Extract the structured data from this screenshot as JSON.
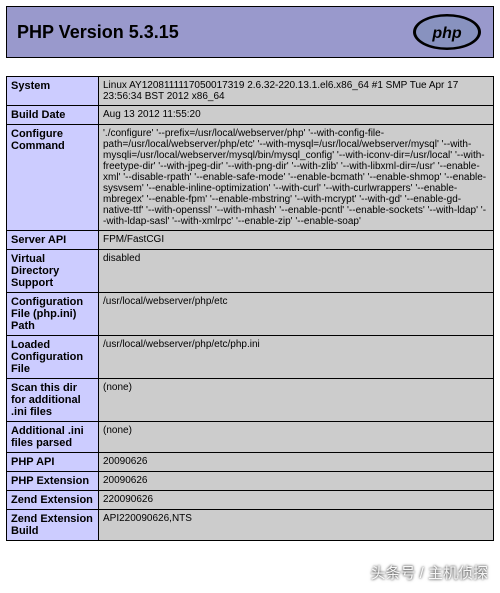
{
  "header": {
    "title": "PHP Version 5.3.15",
    "logo_name": "php-logo"
  },
  "rows": [
    {
      "label": "System",
      "value": "Linux AY1208111117050017319 2.6.32-220.13.1.el6.x86_64 #1 SMP Tue Apr 17 23:56:34 BST 2012 x86_64"
    },
    {
      "label": "Build Date",
      "value": "Aug 13 2012 11:55:20"
    },
    {
      "label": "Configure Command",
      "value": "'./configure' '--prefix=/usr/local/webserver/php' '--with-config-file-path=/usr/local/webserver/php/etc' '--with-mysql=/usr/local/webserver/mysql' '--with-mysqli=/usr/local/webserver/mysql/bin/mysql_config' '--with-iconv-dir=/usr/local' '--with-freetype-dir' '--with-jpeg-dir' '--with-png-dir' '--with-zlib' '--with-libxml-dir=/usr' '--enable-xml' '--disable-rpath' '--enable-safe-mode' '--enable-bcmath' '--enable-shmop' '--enable-sysvsem' '--enable-inline-optimization' '--with-curl' '--with-curlwrappers' '--enable-mbregex' '--enable-fpm' '--enable-mbstring' '--with-mcrypt' '--with-gd' '--enable-gd-native-ttf' '--with-openssl' '--with-mhash' '--enable-pcntl' '--enable-sockets' '--with-ldap' '--with-ldap-sasl' '--with-xmlrpc' '--enable-zip' '--enable-soap'"
    },
    {
      "label": "Server API",
      "value": "FPM/FastCGI"
    },
    {
      "label": "Virtual Directory Support",
      "value": "disabled"
    },
    {
      "label": "Configuration File (php.ini) Path",
      "value": "/usr/local/webserver/php/etc"
    },
    {
      "label": "Loaded Configuration File",
      "value": "/usr/local/webserver/php/etc/php.ini"
    },
    {
      "label": "Scan this dir for additional .ini files",
      "value": "(none)"
    },
    {
      "label": "Additional .ini files parsed",
      "value": "(none)"
    },
    {
      "label": "PHP API",
      "value": "20090626"
    },
    {
      "label": "PHP Extension",
      "value": "20090626"
    },
    {
      "label": "Zend Extension",
      "value": "220090626"
    },
    {
      "label": "Zend Extension Build",
      "value": "API220090626,NTS"
    }
  ],
  "watermark": "头条号 / 主机侦探"
}
